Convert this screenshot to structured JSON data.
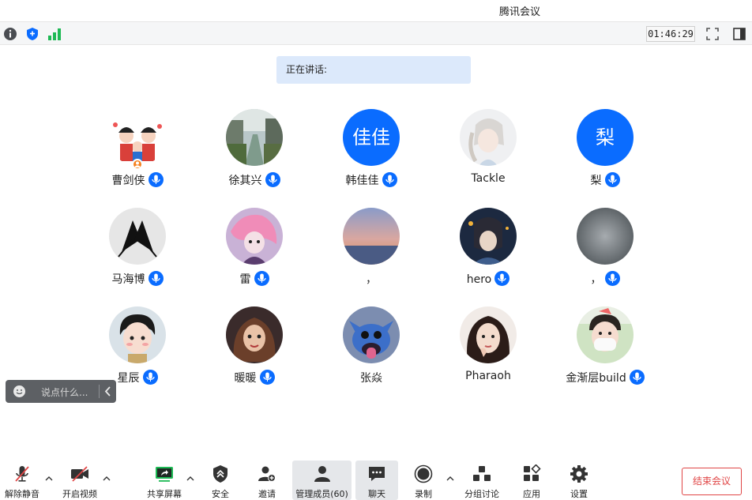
{
  "window": {
    "title": "腾讯会议"
  },
  "top_toolbar": {
    "timer": "01:46:29"
  },
  "speaking": {
    "label": "正在讲话:"
  },
  "participants": [
    {
      "name": "曹剑侠",
      "mic": true,
      "host": true,
      "avatar": "photo"
    },
    {
      "name": "徐其兴",
      "mic": true,
      "avatar": "photo"
    },
    {
      "name": "韩佳佳",
      "mic": true,
      "avatar": "text",
      "avatar_text": "佳佳"
    },
    {
      "name": "Tackle",
      "mic": false,
      "avatar": "photo"
    },
    {
      "name": "梨",
      "mic": true,
      "avatar": "text",
      "avatar_text": "梨"
    },
    {
      "name": "马海博",
      "mic": true,
      "avatar": "photo"
    },
    {
      "name": "雷",
      "mic": true,
      "avatar": "photo"
    },
    {
      "name": "，",
      "mic": false,
      "avatar": "photo"
    },
    {
      "name": "hero",
      "mic": true,
      "avatar": "photo"
    },
    {
      "name": "，",
      "mic": true,
      "avatar": "photo"
    },
    {
      "name": "星辰",
      "mic": true,
      "avatar": "photo"
    },
    {
      "name": "暖暖",
      "mic": true,
      "avatar": "photo"
    },
    {
      "name": "张焱",
      "mic": false,
      "avatar": "photo"
    },
    {
      "name": "Pharaoh",
      "mic": false,
      "avatar": "photo"
    },
    {
      "name": "金渐层build",
      "mic": true,
      "avatar": "photo"
    }
  ],
  "chat": {
    "placeholder": "说点什么..."
  },
  "bottom_toolbar": {
    "unmute": "解除静音",
    "start_video": "开启视频",
    "share_screen": "共享屏幕",
    "security": "安全",
    "invite": "邀请",
    "manage_members": "管理成员(60)",
    "chat": "聊天",
    "record": "录制",
    "breakout": "分组讨论",
    "apps": "应用",
    "settings": "设置",
    "end_meeting": "结束会议"
  },
  "colors": {
    "accent": "#0a6cff",
    "danger": "#e04646",
    "speaking_bg": "#dce9fb"
  }
}
